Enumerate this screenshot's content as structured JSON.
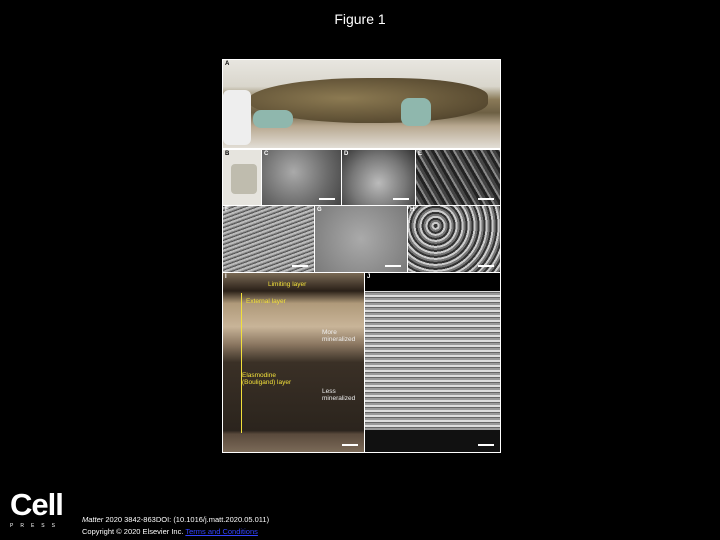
{
  "slide": {
    "title": "Figure 1"
  },
  "figure": {
    "panels": {
      "A": "A",
      "B": "B",
      "C": "C",
      "D": "D",
      "E": "E",
      "F": "F",
      "G": "G",
      "H": "H",
      "I": "I",
      "J": "J"
    },
    "annotations": {
      "limiting_layer": "Limiting layer",
      "external_layer": "External layer",
      "more_mineralized": "More mineralized",
      "elasmodine": "Elasmodine (Bouligand) layer",
      "less_mineralized": "Less mineralized"
    }
  },
  "footer": {
    "logo": "Cell",
    "logo_sub": "PRESS",
    "journal": "Matter",
    "citation": " 2020 3842-863DOI: (10.1016/j.matt.2020.05.011)",
    "copyright": "Copyright © 2020 Elsevier Inc. ",
    "terms_link": "Terms and Conditions"
  }
}
